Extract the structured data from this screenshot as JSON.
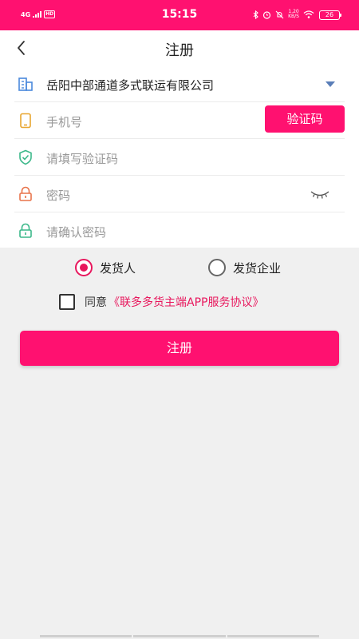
{
  "status_bar": {
    "network": "4G",
    "hd": "HD",
    "time": "15:15",
    "speed_value": "1.20",
    "speed_unit": "KB/S",
    "battery": "26"
  },
  "nav": {
    "title": "注册"
  },
  "form": {
    "company": "岳阳中部通道多式联运有限公司",
    "phone_placeholder": "手机号",
    "code_button": "验证码",
    "code_placeholder": "请填写验证码",
    "password_placeholder": "密码",
    "confirm_placeholder": "请确认密码"
  },
  "roles": {
    "shipper": "发货人",
    "enterprise": "发货企业",
    "selected": "shipper"
  },
  "agreement": {
    "prefix": "同意",
    "link": "《联多多货主端APP服务协议》",
    "checked": false
  },
  "register_button": "注册",
  "colors": {
    "brand": "#ff1170",
    "accent": "#e8175d",
    "page_bg": "#f0f0f0"
  }
}
